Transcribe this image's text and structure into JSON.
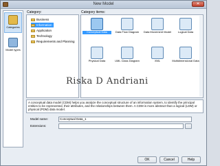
{
  "window": {
    "title": "New Model",
    "close_glyph": "✕"
  },
  "left_rail": {
    "items": [
      {
        "label": "Categories",
        "icon": "categories-icon",
        "selected": true
      },
      {
        "label": "Model types",
        "icon": "model-types-icon",
        "selected": false
      }
    ]
  },
  "category": {
    "label": "Category:",
    "items": [
      {
        "label": "Business",
        "selected": false
      },
      {
        "label": "Information",
        "selected": true
      },
      {
        "label": "Application",
        "selected": false
      },
      {
        "label": "Technology",
        "selected": false
      },
      {
        "label": "Requirements and Planning",
        "selected": false
      }
    ]
  },
  "category_items": {
    "label": "Category items:",
    "items": [
      {
        "label": "Conceptual Data",
        "icon": "conceptual-data-icon",
        "selected": true
      },
      {
        "label": "Data Flow Diagram",
        "icon": "data-flow-diagram-icon",
        "selected": false
      },
      {
        "label": "Data Movement Model",
        "icon": "data-movement-model-icon",
        "selected": false
      },
      {
        "label": "Logical Data",
        "icon": "logical-data-icon",
        "selected": false
      },
      {
        "label": "Physical Data",
        "icon": "physical-data-icon",
        "selected": false
      },
      {
        "label": "UML Class Diagram",
        "icon": "uml-class-diagram-icon",
        "selected": false
      },
      {
        "label": "XML",
        "icon": "xml-icon",
        "selected": false
      },
      {
        "label": "Multidimensional Data",
        "icon": "multidimensional-data-icon",
        "selected": false
      }
    ]
  },
  "watermark": "Riska D Andriani",
  "description": "A conceptual data model (CDM) helps you analyze the conceptual structure of an information system, to identify the principal entities to be represented, their attributes, and the relationships between them. A CDM is more abstract than a logical (LDM) or physical (PDM) data model.",
  "form": {
    "model_name_label": "Model name:",
    "model_name_value": "Conceptual Data_1",
    "extensions_label": "Extensions:",
    "extensions_value": ""
  },
  "buttons": {
    "ok": "OK",
    "cancel": "Cancel",
    "help": "Help"
  },
  "colors": {
    "selection": "#3399ff",
    "titlebar": "#b9c7d8",
    "close": "#c2402b"
  }
}
